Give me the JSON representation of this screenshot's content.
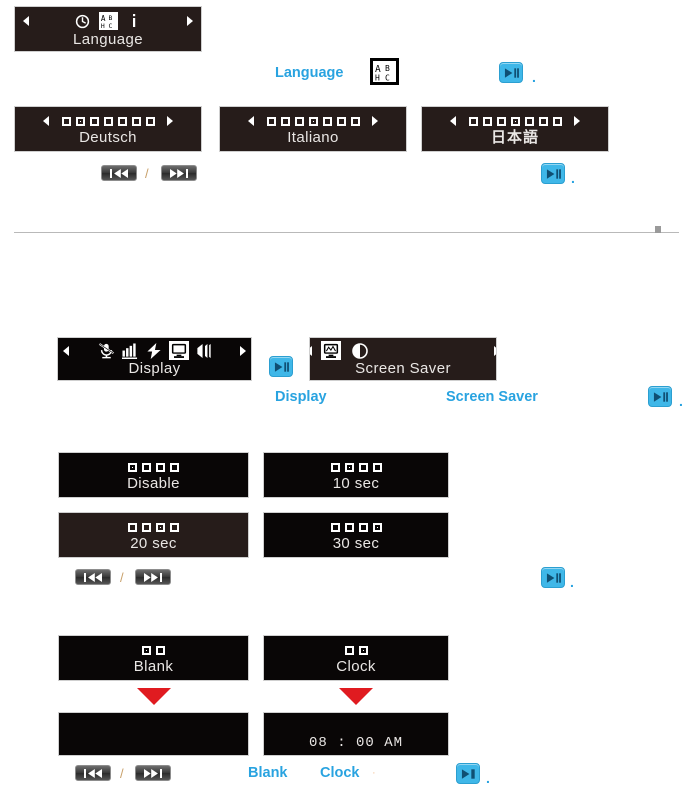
{
  "doc": {
    "accent_blue": "#29a3e0",
    "lcd_bg_brown": "#261c1a",
    "lcd_bg_black": "#090606",
    "lcd_text": "#e9e6e4",
    "red_arrow": "#e01b20"
  },
  "section_language": {
    "menu_panel": {
      "label": "Language",
      "icons": [
        "clock-icon",
        "abc-icon",
        "info-icon"
      ],
      "selected_icon_index": 1,
      "has_left_arrow": true,
      "has_right_arrow": true
    },
    "instruction": {
      "label": "Language",
      "icon": "abc-icon",
      "button": "play-pause-button",
      "trailing": "."
    },
    "options": [
      {
        "label": "Deutsch",
        "dots": 7,
        "selected": 1,
        "style": "brown"
      },
      {
        "label": "Italiano",
        "dots": 7,
        "selected": 3,
        "style": "brown"
      },
      {
        "label": "日本語",
        "dots": 7,
        "selected": 3,
        "style": "brown"
      }
    ],
    "nav_row": {
      "prev_button": "previous-track-button",
      "separator": "/",
      "next_button": "next-track-button",
      "confirm_button": "play-pause-button",
      "trailing": "."
    }
  },
  "section_display": {
    "menu_panel": {
      "label": "Display",
      "icons": [
        "mic-mute-icon",
        "equalizer-icon",
        "lightning-icon",
        "monitor-icon",
        "speaker-icon"
      ],
      "selected_icon_index": 3,
      "has_left_arrow": true,
      "has_right_arrow": true
    },
    "step_button": "play-pause-button",
    "submenu_panel": {
      "label": "Screen Saver",
      "icons": [
        "screensaver-monitor-icon",
        "contrast-icon"
      ],
      "selected_icon_index": 0,
      "has_left_arrow": true,
      "has_right_arrow": true
    },
    "instruction": {
      "display_label": "Display",
      "screensaver_label": "Screen Saver",
      "button": "play-pause-button",
      "trailing": "."
    },
    "timeout_options": [
      {
        "label": "Disable",
        "dots": 4,
        "selected": 0,
        "style": "black"
      },
      {
        "label": "10 sec",
        "dots": 4,
        "selected": 1,
        "style": "black"
      },
      {
        "label": "20 sec",
        "dots": 4,
        "selected": 2,
        "style": "brown"
      },
      {
        "label": "30 sec",
        "dots": 4,
        "selected": 3,
        "style": "black"
      }
    ],
    "timeout_nav_row": {
      "prev_button": "previous-track-button",
      "separator": "/",
      "next_button": "next-track-button",
      "confirm_button": "play-pause-button",
      "trailing": "."
    },
    "mode_options": [
      {
        "label": "Blank",
        "dots": 2,
        "selected": 0,
        "style": "black"
      },
      {
        "label": "Clock",
        "dots": 2,
        "selected": 1,
        "style": "black"
      }
    ],
    "mode_results": [
      {
        "label": "",
        "style": "black"
      },
      {
        "label": "08 : 00 AM",
        "style": "black"
      }
    ],
    "mode_nav_row": {
      "prev_button": "previous-track-button",
      "separator": "/",
      "next_button": "next-track-button",
      "blank_label": "Blank",
      "clock_label": "Clock",
      "faint_mark": "·",
      "confirm_button": "play-pause-button",
      "trailing": "."
    }
  }
}
